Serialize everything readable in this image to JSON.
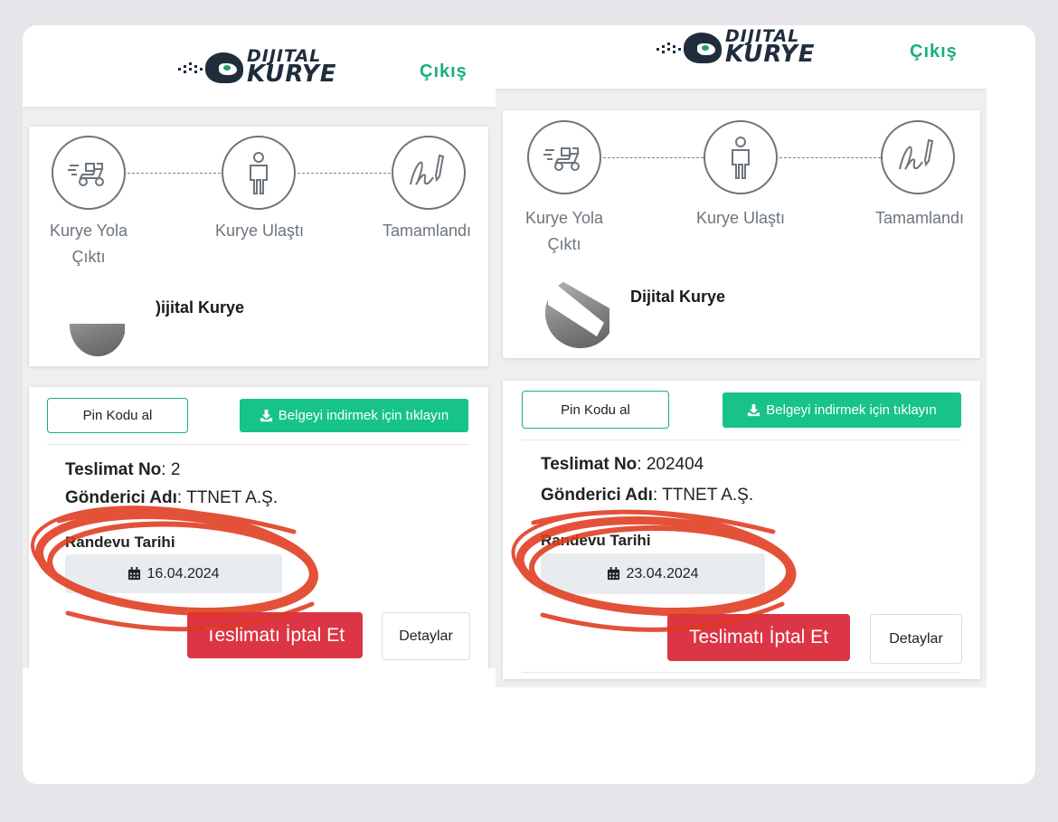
{
  "header": {
    "logo_line1": "DIJITAL",
    "logo_line2": "KURYE",
    "logout": "Çıkış"
  },
  "tracker": {
    "steps": [
      "Kurye Yola",
      "Çıktı",
      "Kurye Ulaştı",
      "Tamamlandı"
    ]
  },
  "courier": {
    "name_left": ")ijital Kurye",
    "name_right": "Dijital Kurye"
  },
  "actions": {
    "pin": "Pin Kodu al",
    "download": "Belgeyi indirmek için tıklayın",
    "cancel": "Teslimatı İptal Et",
    "details": "Detaylar"
  },
  "delivery_left": {
    "no_label": "Teslimat No",
    "no_value": ": 2",
    "sender_label": "Gönderici Adı",
    "sender_value": ": TTNET A.Ş.",
    "date_label": "Randevu Tarihi",
    "date": "16.04.2024"
  },
  "delivery_right": {
    "no_label": "Teslimat No",
    "no_value": ": 202404",
    "sender_label": "Gönderici Adı",
    "sender_value": ": TTNET A.Ş.",
    "date_label": "Randevu Tarihi",
    "date": "23.04.2024"
  },
  "colors": {
    "accent": "#17b07a",
    "download_bg": "#17c38a",
    "danger": "#dc3545",
    "annotation": "#e03a1e"
  },
  "icons": [
    "scooter-icon",
    "person-icon",
    "signature-icon",
    "download-icon",
    "calendar-icon"
  ]
}
